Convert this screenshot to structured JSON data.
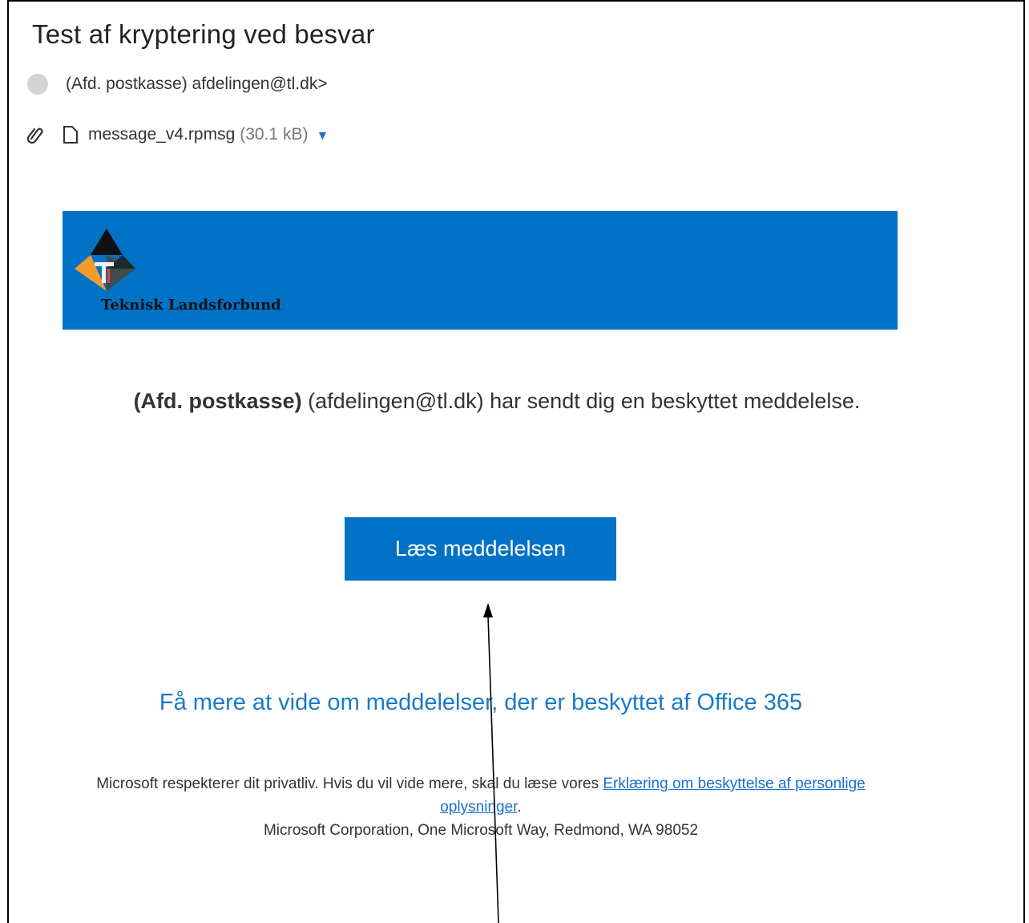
{
  "message": {
    "subject": "Test af kryptering ved besvar",
    "sender": "(Afd. postkasse) afdelingen@tl.dk>",
    "attachment": {
      "filename": "message_v4.rpmsg",
      "size": "(30.1 kB)"
    }
  },
  "banner": {
    "org_name": "Teknisk Landsforbund",
    "color": "#0172c6"
  },
  "notice": {
    "sender_name": "(Afd. postkasse)",
    "text": " (afdelingen@tl.dk) har sendt dig en beskyttet meddelelse."
  },
  "read_button": {
    "label": "Læs meddelelsen"
  },
  "learn_more_link": "Få mere at vide om meddelelser, der er beskyttet af Office 365",
  "footer": {
    "privacy_text": "Microsoft respekterer dit privatliv. Hvis du vil vide mere, skal du læse vores ",
    "privacy_link": "Erklæring om beskyttelse af personlige oplysninger",
    "privacy_end": ".",
    "address": "Microsoft Corporation, One Microsoft Way, Redmond, WA 98052"
  },
  "colors": {
    "accent": "#0172c6",
    "link": "#1a7ac9"
  }
}
